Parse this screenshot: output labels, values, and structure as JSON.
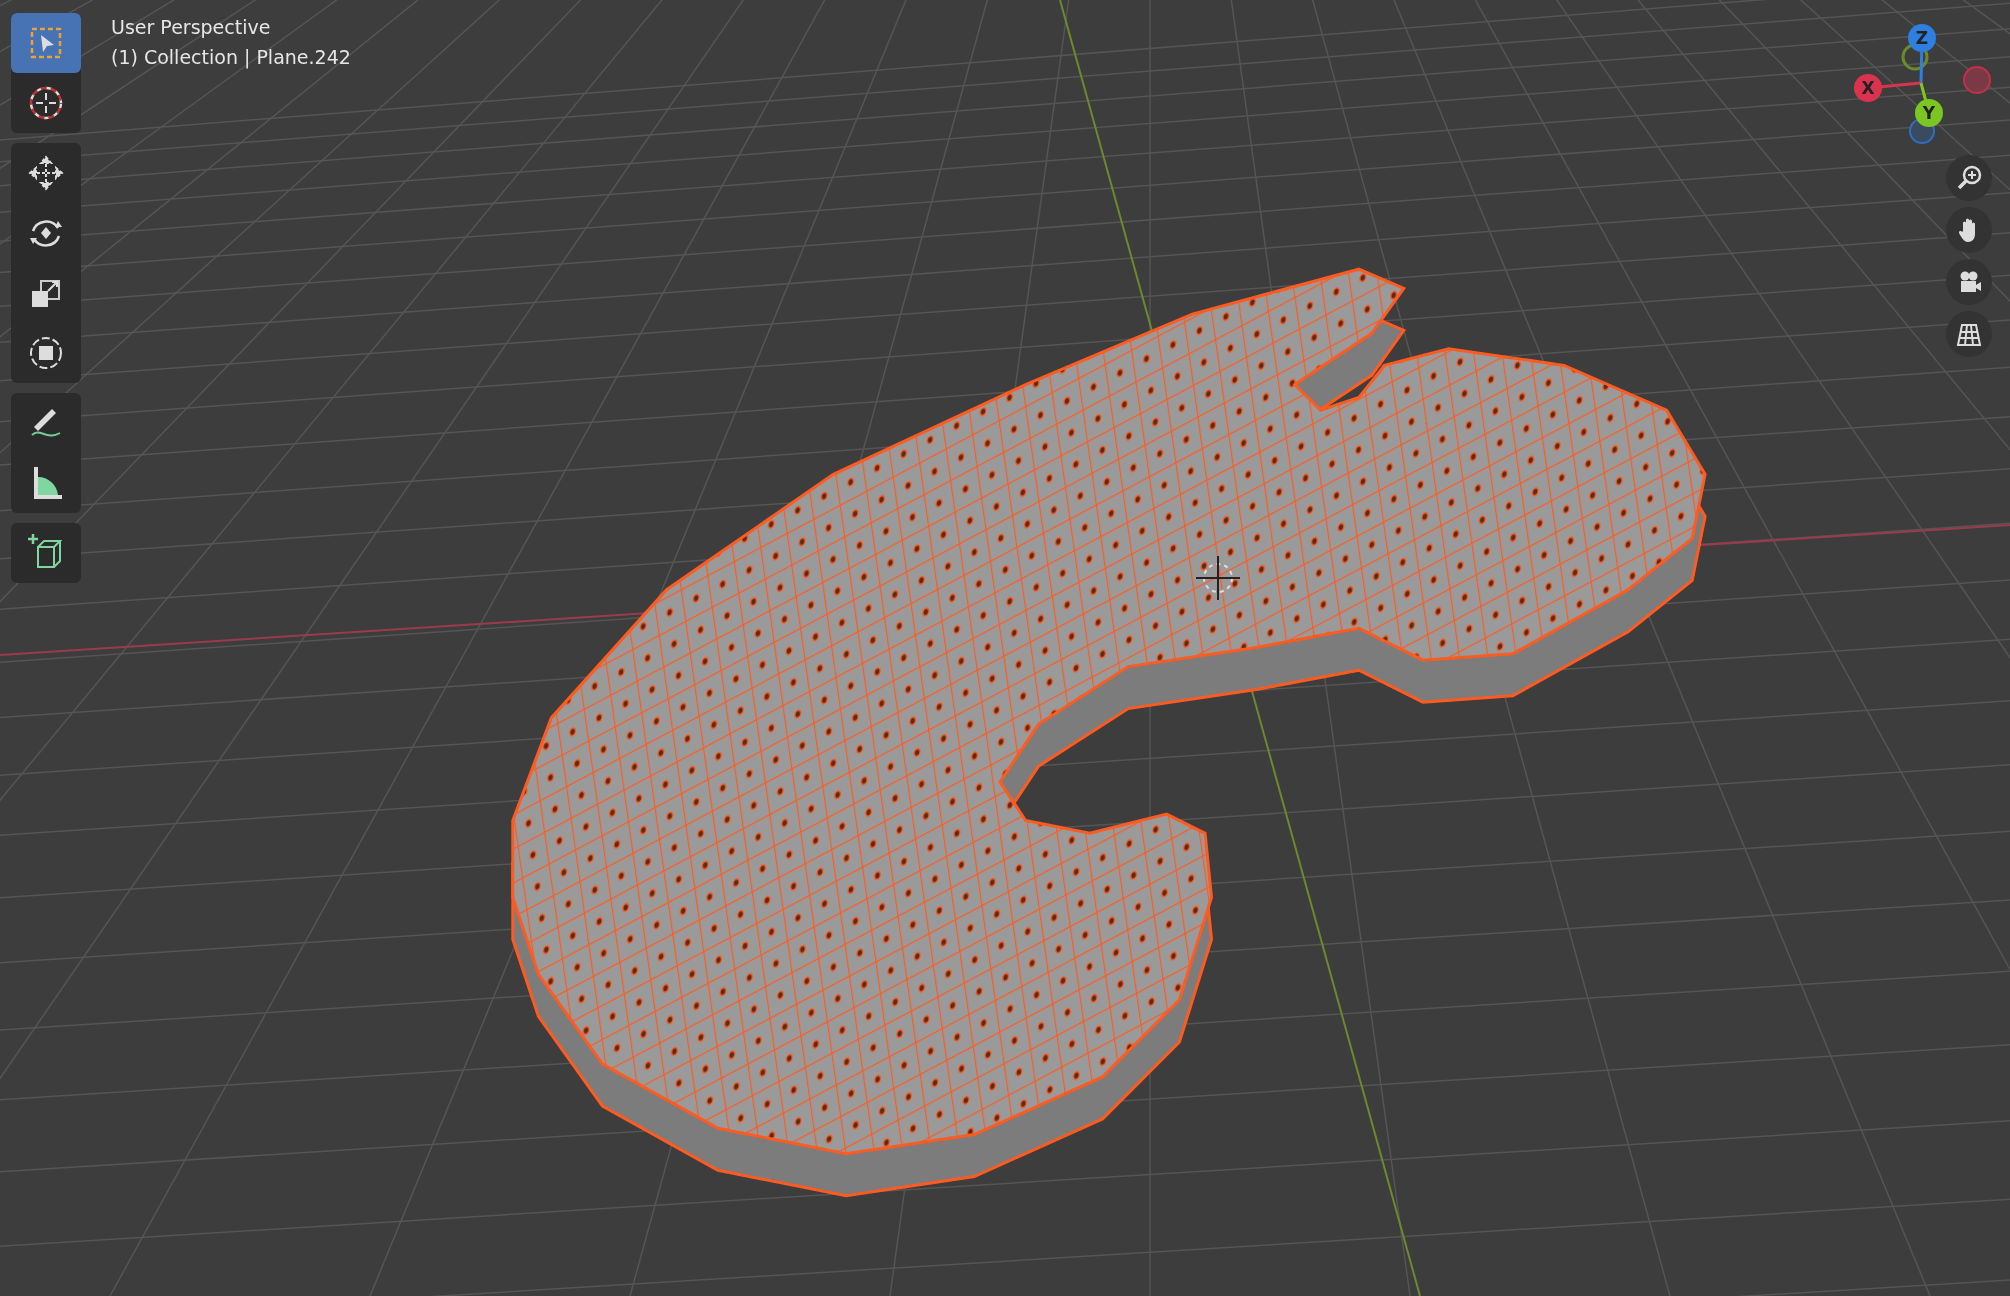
{
  "viewport": {
    "view_name": "User Perspective",
    "object_info": "(1) Collection | Plane.242"
  },
  "toolbar": {
    "groups": [
      {
        "tools": [
          {
            "kind": "select",
            "selected": true
          },
          {
            "kind": "cursor",
            "selected": false
          }
        ]
      },
      {
        "tools": [
          {
            "kind": "move",
            "selected": false
          },
          {
            "kind": "rotate",
            "selected": false
          },
          {
            "kind": "scale",
            "selected": false
          },
          {
            "kind": "transform",
            "selected": false
          }
        ]
      },
      {
        "tools": [
          {
            "kind": "annotate",
            "selected": false
          },
          {
            "kind": "measure",
            "selected": false
          }
        ]
      },
      {
        "tools": [
          {
            "kind": "add-cube",
            "selected": false
          }
        ]
      }
    ]
  },
  "axis_gizmo": {
    "axes": [
      {
        "kind": "z",
        "label": "Z"
      },
      {
        "kind": "x",
        "label": "X"
      },
      {
        "kind": "y",
        "label": "Y"
      }
    ]
  },
  "navigation": [
    {
      "kind": "zoom"
    },
    {
      "kind": "pan"
    },
    {
      "kind": "camera"
    },
    {
      "kind": "ortho"
    }
  ]
}
